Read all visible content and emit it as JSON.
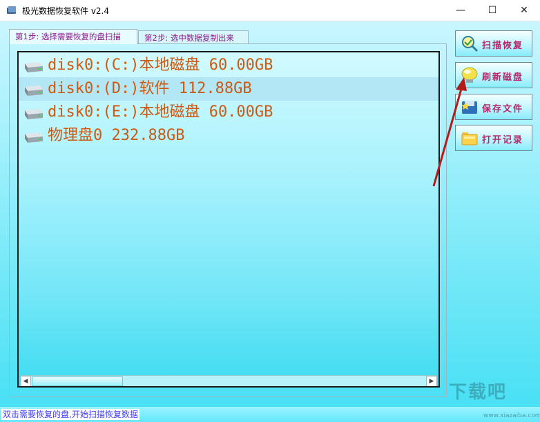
{
  "window": {
    "title": "极光数据恢复软件 v2.4",
    "minimize_glyph": "—",
    "maximize_glyph": "☐",
    "close_glyph": "✕"
  },
  "tabs": [
    {
      "label": "第1步: 选择需要恢复的盘扫描",
      "selected": true
    },
    {
      "label": "第2步: 选中数据复制出来",
      "selected": false
    }
  ],
  "disks": [
    {
      "label": "disk0:(C:)本地磁盘 60.00GB",
      "selected": false
    },
    {
      "label": "disk0:(D:)软件 112.88GB",
      "selected": true
    },
    {
      "label": "disk0:(E:)本地磁盘 60.00GB",
      "selected": false
    },
    {
      "label": "物理盘0 232.88GB",
      "selected": false
    }
  ],
  "scrollbar": {
    "left_arrow": "◀",
    "right_arrow": "▶"
  },
  "buttons": [
    {
      "label": "扫描恢复",
      "icon": "scan-icon"
    },
    {
      "label": "刷新磁盘",
      "icon": "refresh-icon"
    },
    {
      "label": "保存文件",
      "icon": "save-icon"
    },
    {
      "label": "打开记录",
      "icon": "folder-icon"
    }
  ],
  "status": {
    "text": "双击需要恢复的盘,开始扫描恢复数据"
  },
  "watermark": {
    "text": "下载吧",
    "url": "www.xiazaiba.com"
  },
  "colors": {
    "disk_text": "#cc5a12",
    "button_text": "#b8286b",
    "tab_text": "#8b1a8b",
    "status_text": "#3a3aff",
    "selected_row": "#b3e7f5"
  }
}
